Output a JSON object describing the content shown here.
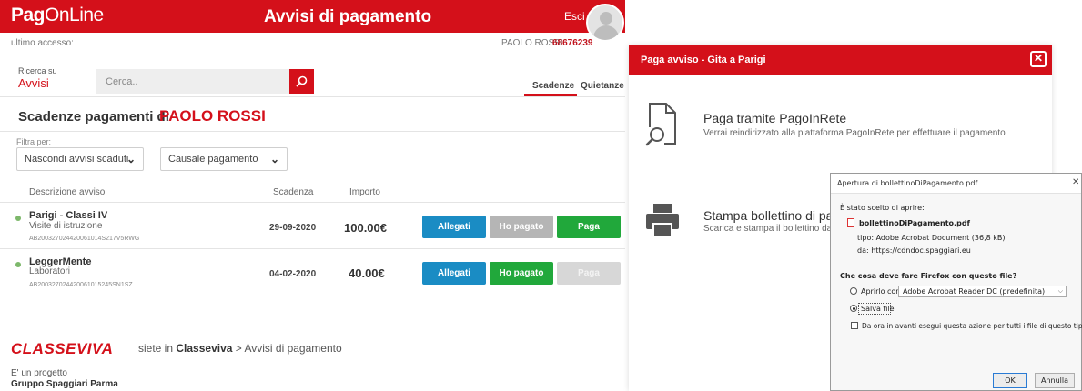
{
  "app": {
    "logo_bold": "Pag",
    "logo_light": "OnLine",
    "title": "Avvisi di pagamento",
    "logout": "Esci",
    "last_access": "ultimo accesso:",
    "user_name": "PAOLO ROSSI",
    "user_code": "68676239"
  },
  "search": {
    "label_small": "Ricerca su",
    "label_big": "Avvisi",
    "placeholder": "Cerca.."
  },
  "tabs": [
    {
      "label": "Scadenze",
      "active": true
    },
    {
      "label": "Quietanze",
      "active": false
    }
  ],
  "heading": {
    "prefix": "Scadenze pagamenti di",
    "name": "PAOLO ROSSI"
  },
  "filters": {
    "label": "Filtra per:",
    "select1": "Nascondi avvisi scaduti",
    "select2": "Causale pagamento"
  },
  "table": {
    "headers": [
      "Descrizione avviso",
      "Scadenza",
      "Importo"
    ],
    "rows": [
      {
        "title": "Parigi - Classi IV",
        "subtitle": "Visite di istruzione",
        "code": "AB200327024420061014S217V5RWG",
        "date": "29-09-2020",
        "amount": "100.00€",
        "btn_attachments": "Allegati",
        "btn_paid": "Ho pagato",
        "btn_pay": "Paga"
      },
      {
        "title": "LeggerMente",
        "subtitle": "Laboratori",
        "code": "AB200327024420061015245SN1SZ",
        "date": "04-02-2020",
        "amount": "40.00€",
        "btn_attachments": "Allegati",
        "btn_paid": "Ho pagato",
        "btn_pay": "Paga"
      }
    ]
  },
  "footer": {
    "logo": "CLASSEVIVA",
    "path_prefix": "siete in",
    "path_bold": "Classeviva",
    "path_rest": "> Avvisi di pagamento",
    "project": "E' un progetto",
    "company": "Gruppo Spaggiari Parma"
  },
  "modal": {
    "title": "Paga avviso - Gita a Parigi",
    "option1_title": "Paga tramite PagoInRete",
    "option1_desc": "Verrai reindirizzato alla piattaforma PagoInRete per effettuare il pagamento",
    "option2_title": "Stampa bollettino di pag",
    "option2_desc": "Scarica e stampa il bollettino da"
  },
  "dialog": {
    "title": "Apertura di bollettinoDiPagamento.pdf",
    "chosen_text": "È stato scelto di aprire:",
    "filename": "bollettinoDiPagamento.pdf",
    "type_text": "tipo: Adobe Acrobat Document (36,8 kB)",
    "from_text": "da: https://cdndoc.spaggiari.eu",
    "question": "Che cosa deve fare Firefox con questo file?",
    "open_with_label": "Aprirlo con",
    "open_with_app": "Adobe Acrobat Reader DC (predefinita)",
    "save_label": "Salva file",
    "always_label": "Da ora in avanti esegui questa azione per tutti i file di questo tipo.",
    "ok": "OK",
    "cancel": "Annulla"
  },
  "colors": {
    "brand_red": "#d4101a",
    "button_blue": "#1a8cc4",
    "button_green": "#21a83b",
    "button_grey": "#b5b5b5",
    "status_dot": "#7db86b"
  }
}
